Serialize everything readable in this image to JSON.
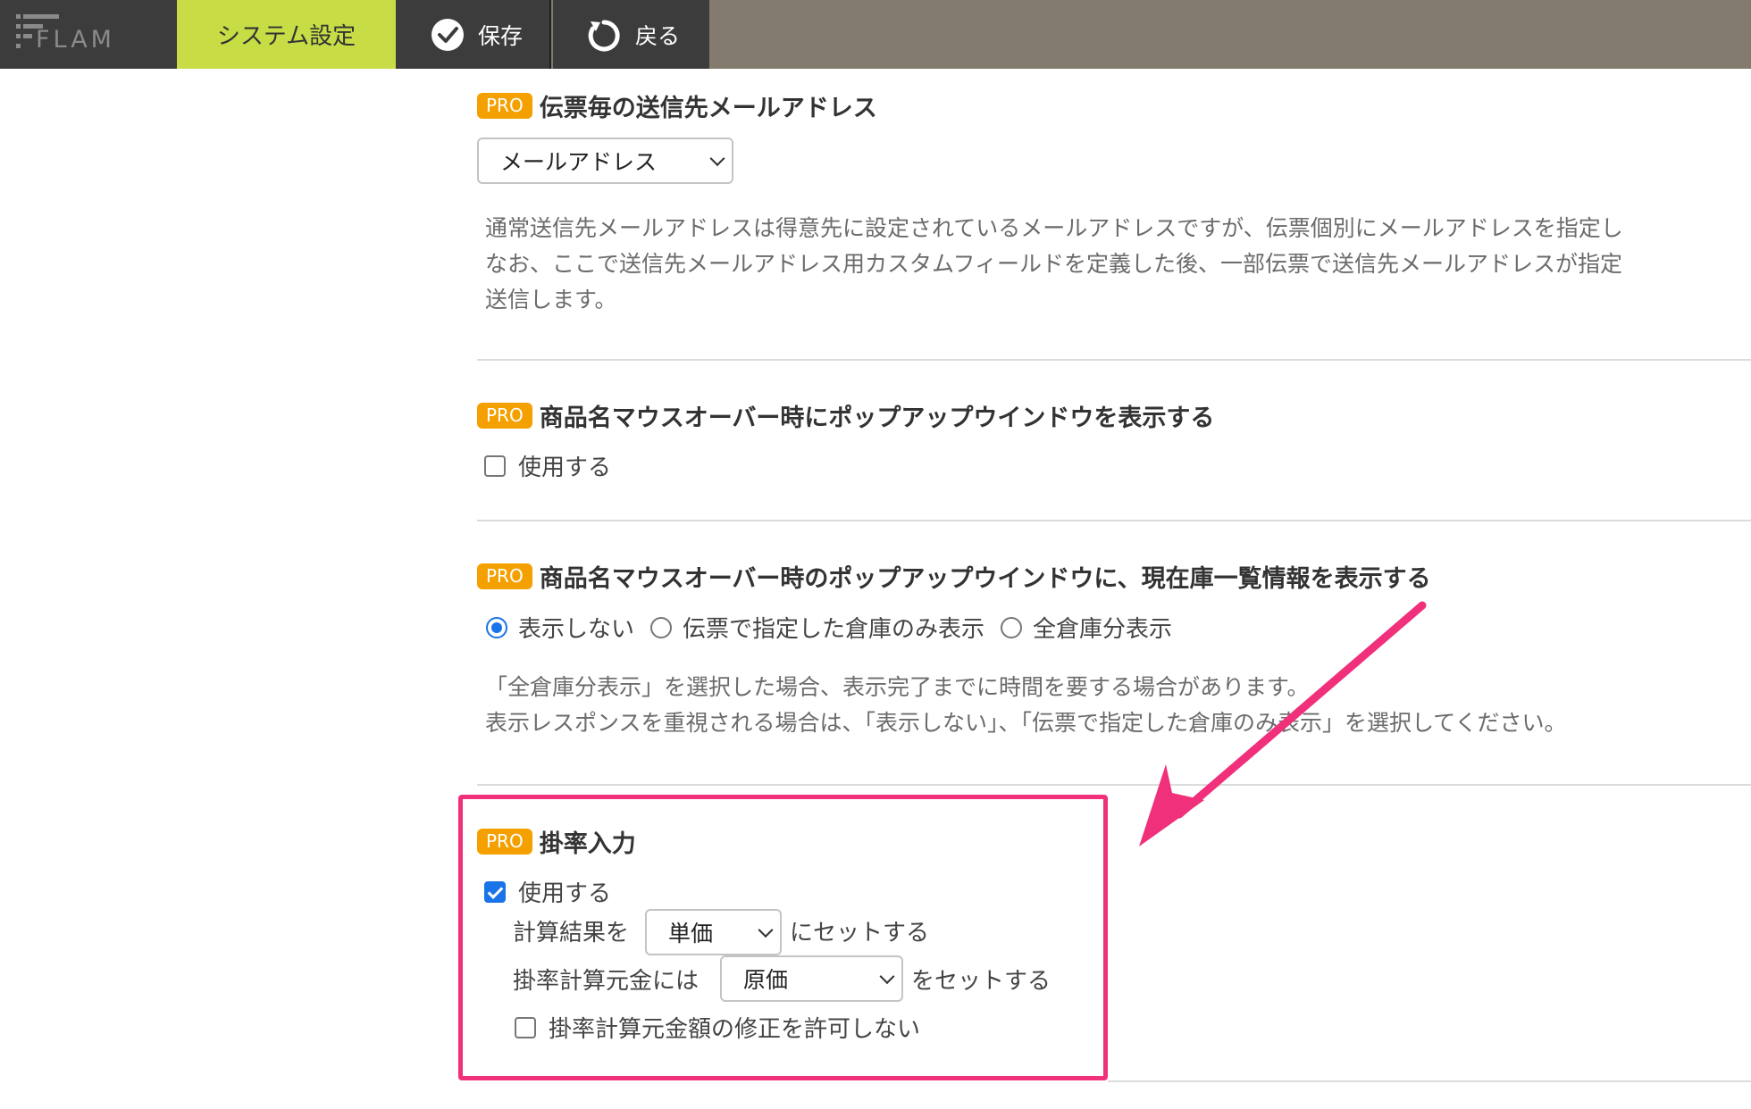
{
  "topbar": {
    "logo": "FLAM",
    "tab_label": "システム設定",
    "save_label": "保存",
    "back_label": "戻る"
  },
  "section_email": {
    "badge": "PRO",
    "title": "伝票毎の送信先メールアドレス",
    "select_value": "メールアドレス",
    "desc_lines": [
      "通常送信先メールアドレスは得意先に設定されているメールアドレスですが、伝票個別にメールアドレスを指定し",
      "なお、ここで送信先メールアドレス用カスタムフィールドを定義した後、一部伝票で送信先メールアドレスが指定",
      "送信します。"
    ]
  },
  "section_popup": {
    "badge": "PRO",
    "title": "商品名マウスオーバー時にポップアップウインドウを表示する",
    "checkbox_label": "使用する",
    "checked": false
  },
  "section_stock": {
    "badge": "PRO",
    "title": "商品名マウスオーバー時のポップアップウインドウに、現在庫一覧情報を表示する",
    "options": [
      "表示しない",
      "伝票で指定した倉庫のみ表示",
      "全倉庫分表示"
    ],
    "selected": "表示しない",
    "desc_lines": [
      "「全倉庫分表示」を選択した場合、表示完了までに時間を要する場合があります。",
      "表示レスポンスを重視される場合は、「表示しない」、「伝票で指定した倉庫のみ表示」を選択してください。"
    ]
  },
  "section_rate": {
    "badge": "PRO",
    "title": "掛率入力",
    "use_label": "使用する",
    "use_checked": true,
    "result_prefix": "計算結果を",
    "result_select": "単価",
    "result_suffix": "にセットする",
    "base_prefix": "掛率計算元金には",
    "base_select": "原価",
    "base_suffix": "をセットする",
    "lock_label": "掛率計算元金額の修正を許可しない",
    "lock_checked": false
  },
  "colors": {
    "tab_active": "#c8dc46",
    "badge": "#f4a000",
    "highlight": "#f0307a",
    "topbar": "#827b6e"
  }
}
